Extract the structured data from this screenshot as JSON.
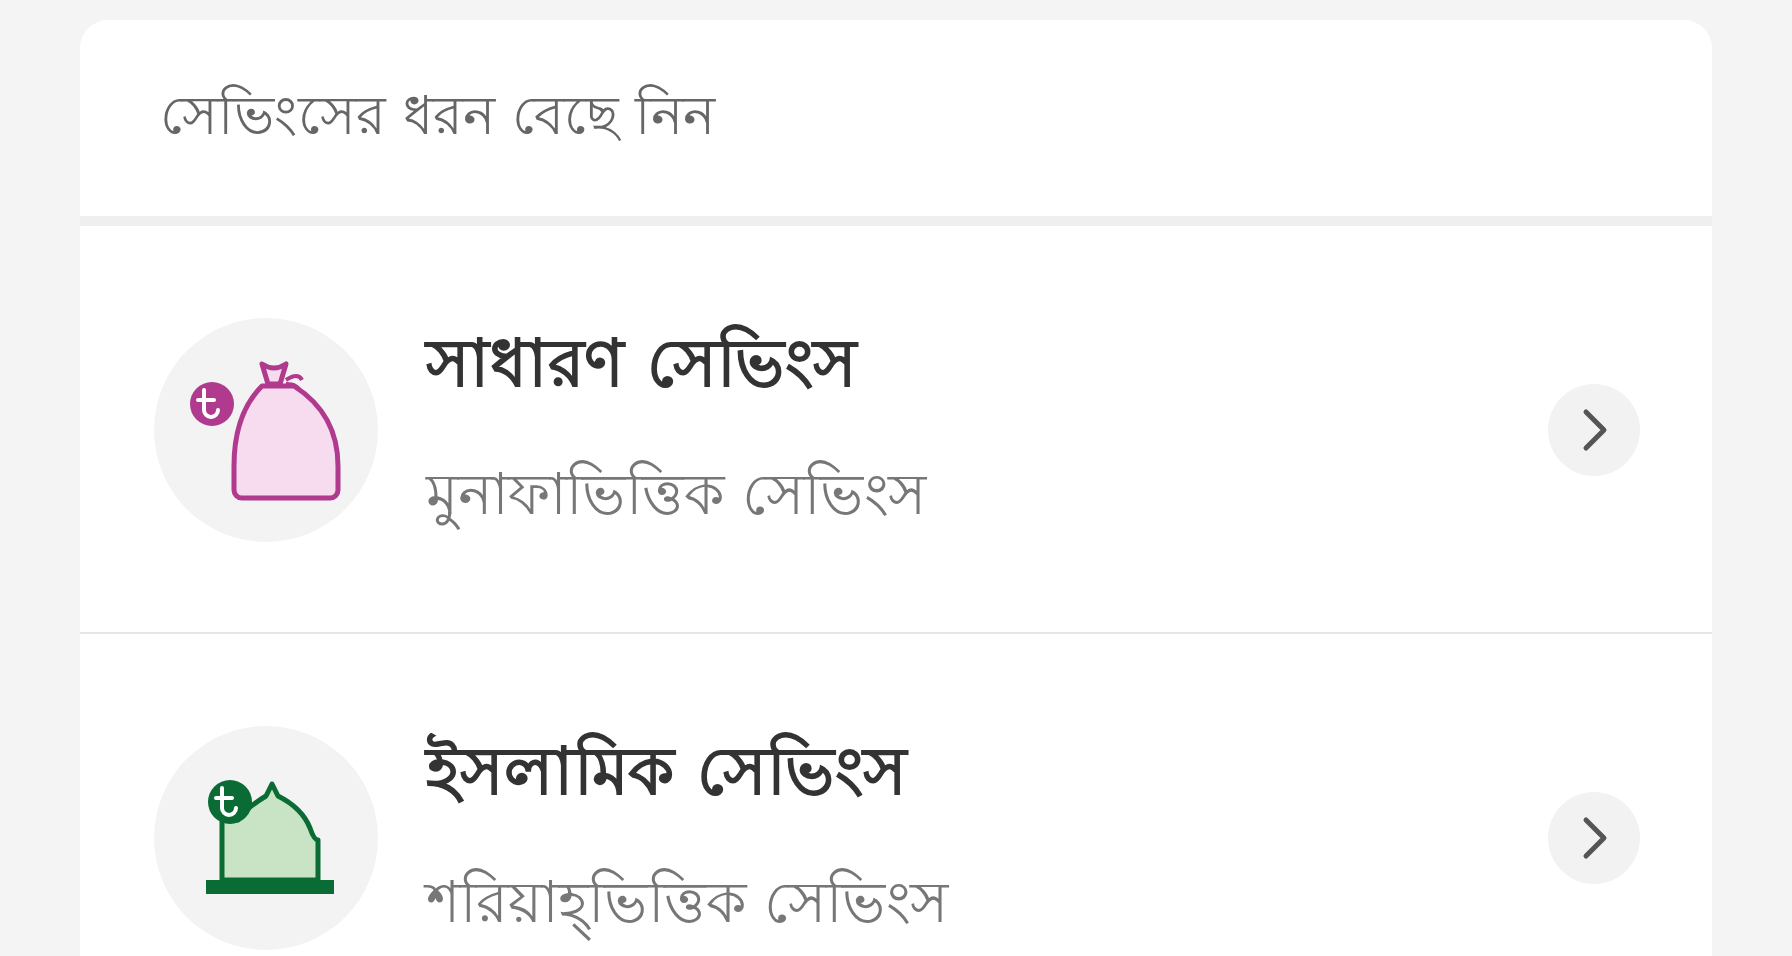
{
  "header": {
    "title": "সেভিংসের ধরন বেছে নিন"
  },
  "options": [
    {
      "kind": "bag",
      "title": "সাধারণ সেভিংস",
      "subtitle": "মুনাফাভিত্তিক সেভিংস"
    },
    {
      "kind": "mosque",
      "title": "ইসলামিক সেভিংস",
      "subtitle": "শরিয়াহ্‌ভিত্তিক সেভিংস"
    }
  ]
}
